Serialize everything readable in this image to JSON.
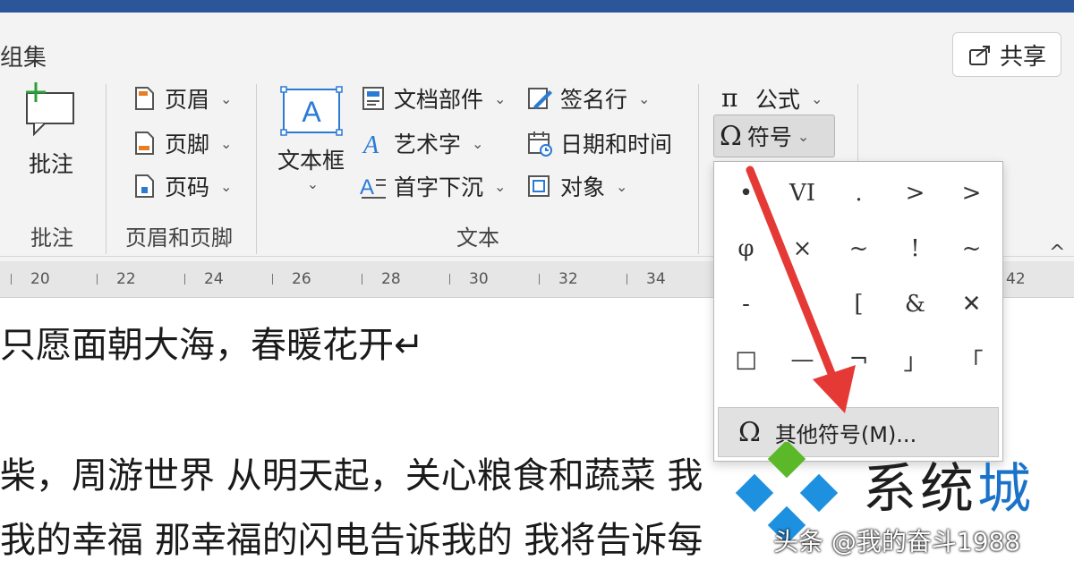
{
  "ribbon": {
    "tab_label": "组集",
    "share_label": "共享",
    "comment": {
      "label": "批注",
      "group": "批注"
    },
    "header_footer": {
      "header": "页眉",
      "footer": "页脚",
      "page_number": "页码",
      "group": "页眉和页脚"
    },
    "text": {
      "textbox": "文本框",
      "doc_parts": "文档部件",
      "wordart": "艺术字",
      "dropcap": "首字下沉",
      "signature": "签名行",
      "datetime": "日期和时间",
      "object": "对象",
      "group": "文本"
    },
    "symbols": {
      "equation": "公式",
      "symbol": "符号"
    },
    "caret": "⌄",
    "collapse": "^"
  },
  "ruler": [
    "20",
    "22",
    "24",
    "26",
    "28",
    "30",
    "32",
    "34",
    "42"
  ],
  "document": {
    "line1": "只愿面朝大海，春暖花开↵",
    "line2": "柴，周游世界 从明天起，关心粮食和蔬菜 我",
    "line3": "我的幸福 那幸福的闪电告诉我的 我将告诉每"
  },
  "symbol_dropdown": {
    "symbols": [
      "•",
      "VI",
      ".",
      ">",
      ">",
      "φ",
      "×",
      "~",
      "!",
      "~",
      "-",
      "",
      "[",
      "&",
      "✕",
      "□",
      "—",
      "¬",
      "」",
      "「"
    ],
    "more_label": "其他符号(M)..."
  },
  "watermark": {
    "brand_main": "系统",
    "brand_accent": "城",
    "sub": "头条 @我的奋斗1988"
  },
  "colors": {
    "titlebar": "#2b579a",
    "arrow": "#e53935",
    "watermark_accent": "#1a73c9"
  }
}
